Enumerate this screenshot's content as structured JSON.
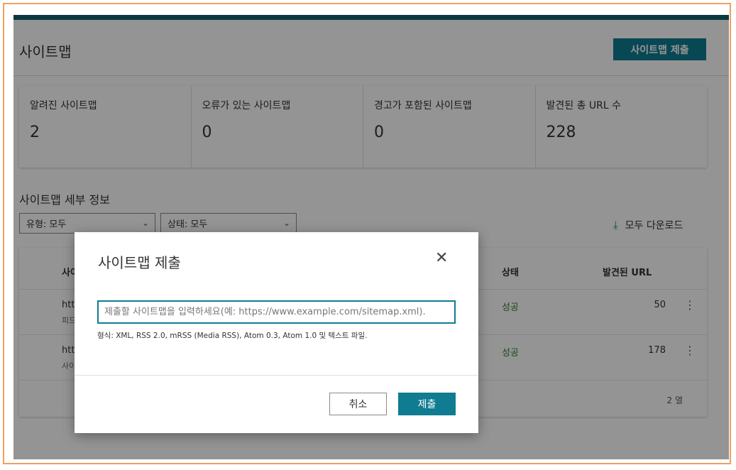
{
  "header": {
    "title": "사이트맵",
    "submit_label": "사이트맵 제출"
  },
  "stats": [
    {
      "label": "알려진 사이트맵",
      "value": "2"
    },
    {
      "label": "오류가 있는 사이트맵",
      "value": "0"
    },
    {
      "label": "경고가 포함된 사이트맵",
      "value": "0"
    },
    {
      "label": "발견된 총 URL 수",
      "value": "228"
    }
  ],
  "details": {
    "title": "사이트맵 세부 정보",
    "filter_type": "유형: 모두",
    "filter_status": "상태: 모두",
    "download_label": "모두 다운로드"
  },
  "table": {
    "columns": {
      "sitemap": "사이",
      "status": "상태",
      "found_urls": "발견된 URL"
    },
    "rows": [
      {
        "url": "htt",
        "sub": "피드",
        "status": "성공",
        "count": "50"
      },
      {
        "url": "htt",
        "sub": "사이",
        "status": "성공",
        "count": "178"
      }
    ],
    "row_count": "2 열"
  },
  "modal": {
    "title": "사이트맵 제출",
    "input_placeholder": "제출할 사이트맵을 입력하세요(예: https://www.example.com/sitemap.xml).",
    "hint": "형식: XML, RSS 2.0, mRSS (Media RSS), Atom 0.3, Atom 1.0 및 텍스트 파일.",
    "cancel_label": "취소",
    "submit_label": "제출"
  },
  "colors": {
    "accent": "#0f7c91",
    "success": "#2e7d32",
    "frame_border": "#f0a060"
  },
  "icons": {
    "close": "close-icon",
    "download": "download-icon",
    "chevron": "chevron-down-icon",
    "more": "more-vertical-icon"
  }
}
